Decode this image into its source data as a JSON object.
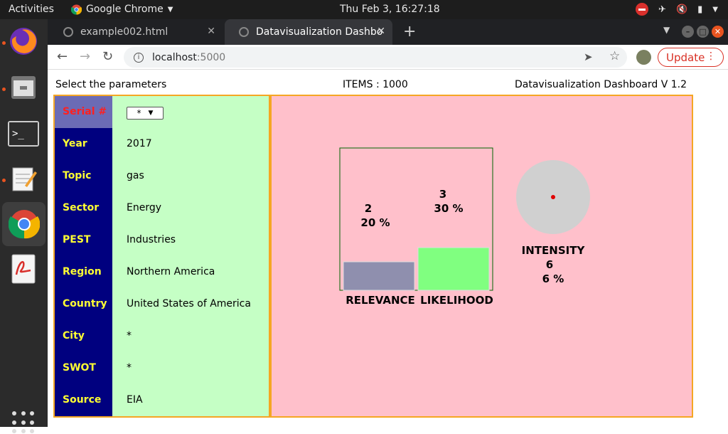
{
  "system": {
    "activities": "Activities",
    "app_name": "Google Chrome",
    "clock": "Thu Feb  3, 16:27:18"
  },
  "browser": {
    "tabs": [
      {
        "title": "example002.html"
      },
      {
        "title": "Datavisualization Dashbo"
      }
    ],
    "url_host": "localhost",
    "url_port": ":5000",
    "update_label": "Update"
  },
  "page": {
    "header_left": "Select the parameters",
    "header_mid": "ITEMS : 1000",
    "header_right": "Datavisualization Dashboard V 1.2"
  },
  "params": [
    {
      "label": "Serial #",
      "value": "*",
      "selected": true
    },
    {
      "label": "Year",
      "value": "2017"
    },
    {
      "label": "Topic",
      "value": "gas"
    },
    {
      "label": "Sector",
      "value": "Energy"
    },
    {
      "label": "PEST",
      "value": "Industries"
    },
    {
      "label": "Region",
      "value": "Northern America"
    },
    {
      "label": "Country",
      "value": "United States of America"
    },
    {
      "label": "City",
      "value": "*"
    },
    {
      "label": "SWOT",
      "value": "*"
    },
    {
      "label": "Source",
      "value": "EIA"
    }
  ],
  "metrics": {
    "relevance": {
      "label": "RELEVANCE",
      "value": "2",
      "percent": "20 %",
      "fraction": 0.2
    },
    "likelihood": {
      "label": "LIKELIHOOD",
      "value": "3",
      "percent": "30 %",
      "fraction": 0.3
    },
    "intensity": {
      "label": "INTENSITY",
      "value": "6",
      "percent": "6 %",
      "fraction": 0.06
    }
  },
  "colors": {
    "relevance_bar": "#8f8fae",
    "likelihood_bar": "#80ff80",
    "chart_border": "#006400",
    "intensity_circle": "#d0d0d0",
    "intensity_dot": "#e00000"
  }
}
